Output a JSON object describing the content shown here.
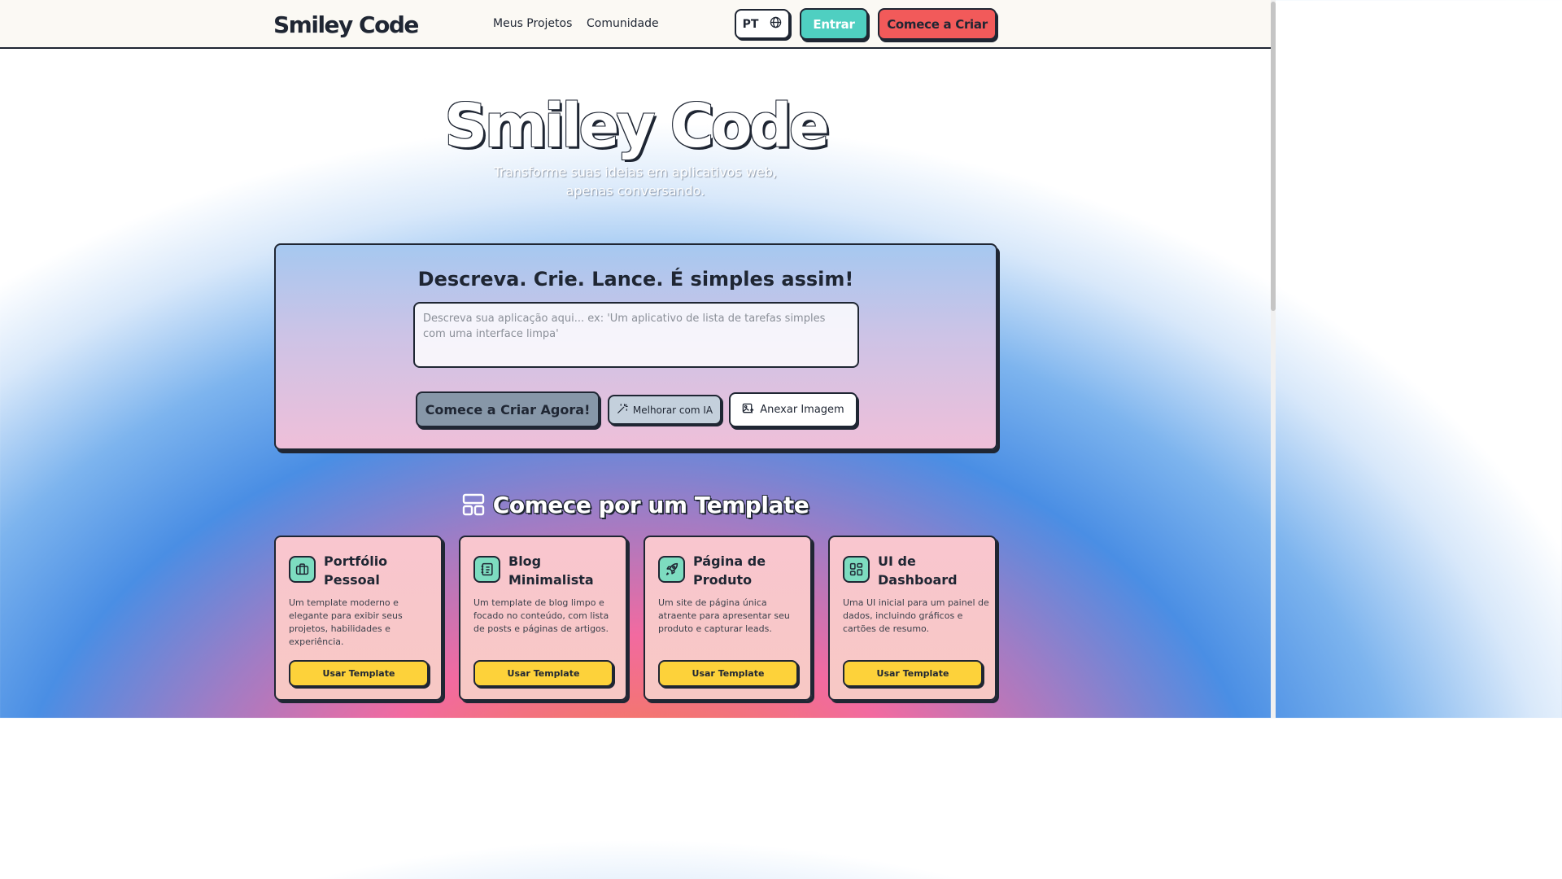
{
  "nav": {
    "logo": "Smiley Code",
    "links": [
      "Meus Projetos",
      "Comunidade"
    ],
    "language": "PT",
    "login": "Entrar",
    "start": "Comece a Criar"
  },
  "hero": {
    "title": "Smiley Code",
    "subtitle": "Transforme suas ideias em aplicativos web, apenas conversando."
  },
  "builder": {
    "heading": "Descreva. Crie. Lance. É simples assim!",
    "placeholder": "Descreva sua aplicação aqui... ex: 'Um aplicativo de lista de tarefas simples com uma interface limpa'",
    "primary_button": "Comece a Criar Agora!",
    "ai_button": "Melhorar com IA",
    "attach_button": "Anexar Imagem"
  },
  "templates": {
    "heading": "Comece por um Template",
    "items": [
      {
        "name": "Portfólio Pessoal",
        "icon": "briefcase-icon",
        "description": "Um template moderno e elegante para exibir seus projetos, habilidades e experiência.",
        "button": "Usar Template"
      },
      {
        "name": "Blog Minimalista",
        "icon": "notebook-icon",
        "description": "Um template de blog limpo e focado no conteúdo, com lista de posts e páginas de artigos.",
        "button": "Usar Template"
      },
      {
        "name": "Página de Produto",
        "icon": "rocket-icon",
        "description": "Um site de página única atraente para apresentar seu produto e capturar leads.",
        "button": "Usar Template"
      },
      {
        "name": "UI de Dashboard",
        "icon": "dashboard-icon",
        "description": "Uma UI inicial para um painel de dados, incluindo gráficos e cartões de resumo.",
        "button": "Usar Template"
      }
    ]
  },
  "colors": {
    "dark": "#1f2633",
    "login_bg": "#4fcfc1",
    "start_bg": "#f25a5a",
    "template_button": "#fdd23a",
    "template_icon_bg": "#7ddcc0"
  }
}
